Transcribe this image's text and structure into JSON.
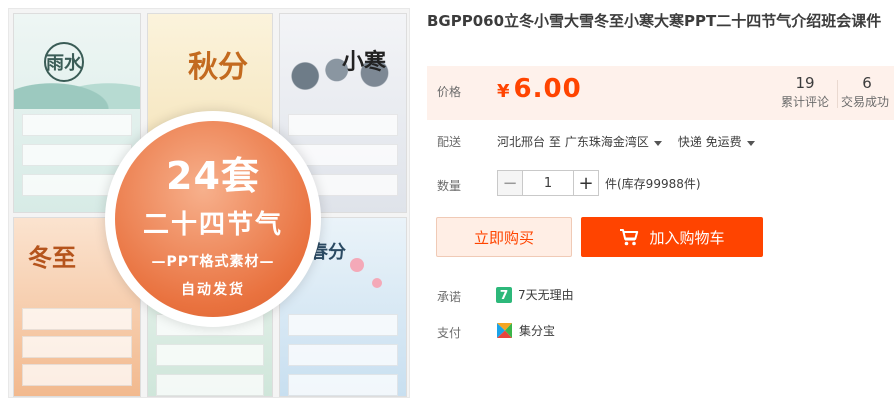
{
  "product": {
    "title": "BGPP060立冬小雪大雪冬至小寒大寒PPT二十四节气介绍班会课件",
    "image": {
      "badge_line1": "24套",
      "badge_line2": "二十四节气",
      "badge_line3": "—PPT格式素材—",
      "badge_line4": "自动发货",
      "tile_labels": [
        "雨水",
        "秋分",
        "小寒",
        "冬至",
        "",
        "春分"
      ]
    }
  },
  "price": {
    "label": "价格",
    "currency": "¥",
    "value": "6.00",
    "stats": [
      {
        "number": "19",
        "label": "累计评论"
      },
      {
        "number": "6",
        "label": "交易成功"
      }
    ]
  },
  "shipping": {
    "label": "配送",
    "origin": "河北邢台 至",
    "destination": "广东珠海金湾区",
    "method": "快递 免运费"
  },
  "quantity": {
    "label": "数量",
    "minus": "−",
    "value": "1",
    "plus": "+",
    "stock": "件(库存99988件)"
  },
  "actions": {
    "buy_now": "立即购买",
    "add_to_cart": "加入购物车"
  },
  "promise": {
    "label": "承诺",
    "icon_text": "7",
    "text": "7天无理由"
  },
  "payment": {
    "label": "支付",
    "text": "集分宝"
  },
  "colors": {
    "accent": "#ff4400",
    "price_bg": "#fef1eb",
    "promise_green": "#2db87a",
    "badge_orange": "#e9723f"
  }
}
